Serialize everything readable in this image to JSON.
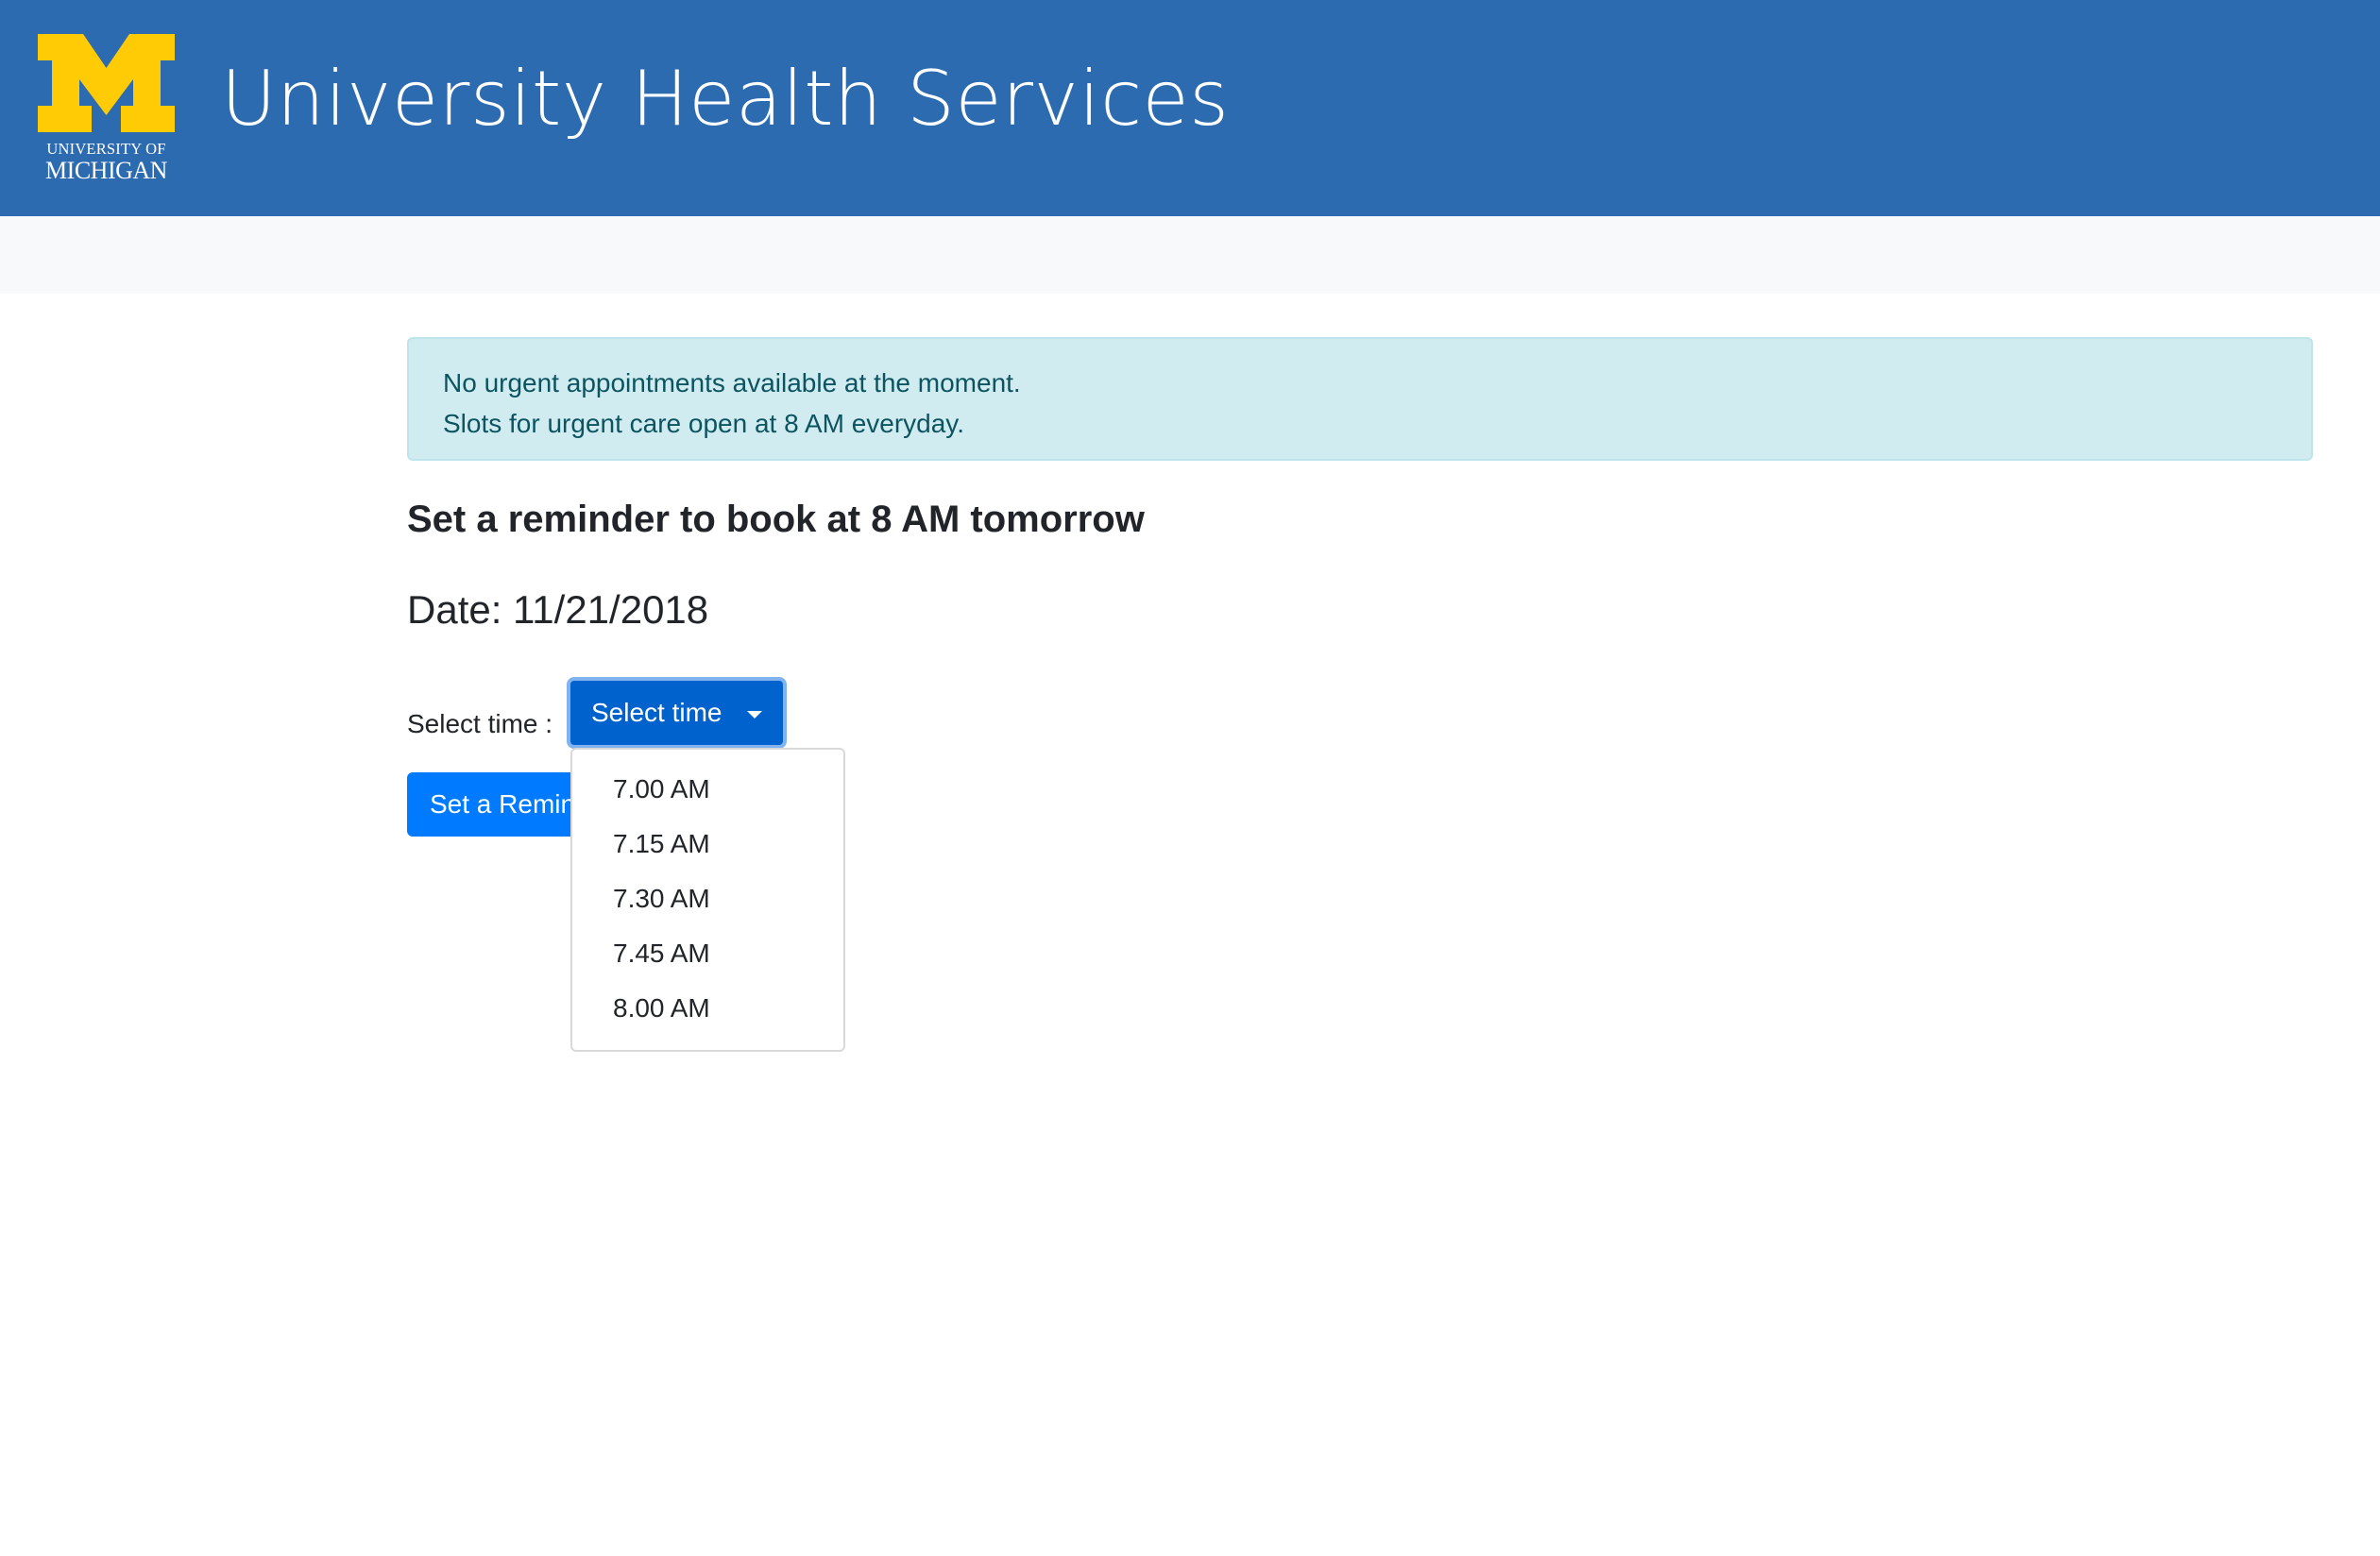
{
  "header": {
    "logo": {
      "icon": "block-m-logo",
      "line1": "UNIVERSITY OF",
      "line2": "MICHIGAN"
    },
    "title": "University Health Services"
  },
  "alert": {
    "line1": "No urgent appointments available at the moment.",
    "line2": "Slots for urgent care open at 8 AM everyday."
  },
  "main": {
    "heading": "Set a reminder to book at 8 AM tomorrow",
    "date_text": "Date: 11/21/2018",
    "time_label": "Select time :",
    "select_button_label": "Select time",
    "reminder_button_label": "Set a Reminder",
    "time_options": [
      "7.00 AM",
      "7.15 AM",
      "7.30 AM",
      "7.45 AM",
      "8.00 AM"
    ]
  },
  "colors": {
    "header_bg": "#2d6bb1",
    "logo_maize": "#ffcb05",
    "alert_bg": "#d1ecf1",
    "alert_text": "#0c5460",
    "primary_button": "#007bff",
    "active_button": "#0062cc"
  }
}
